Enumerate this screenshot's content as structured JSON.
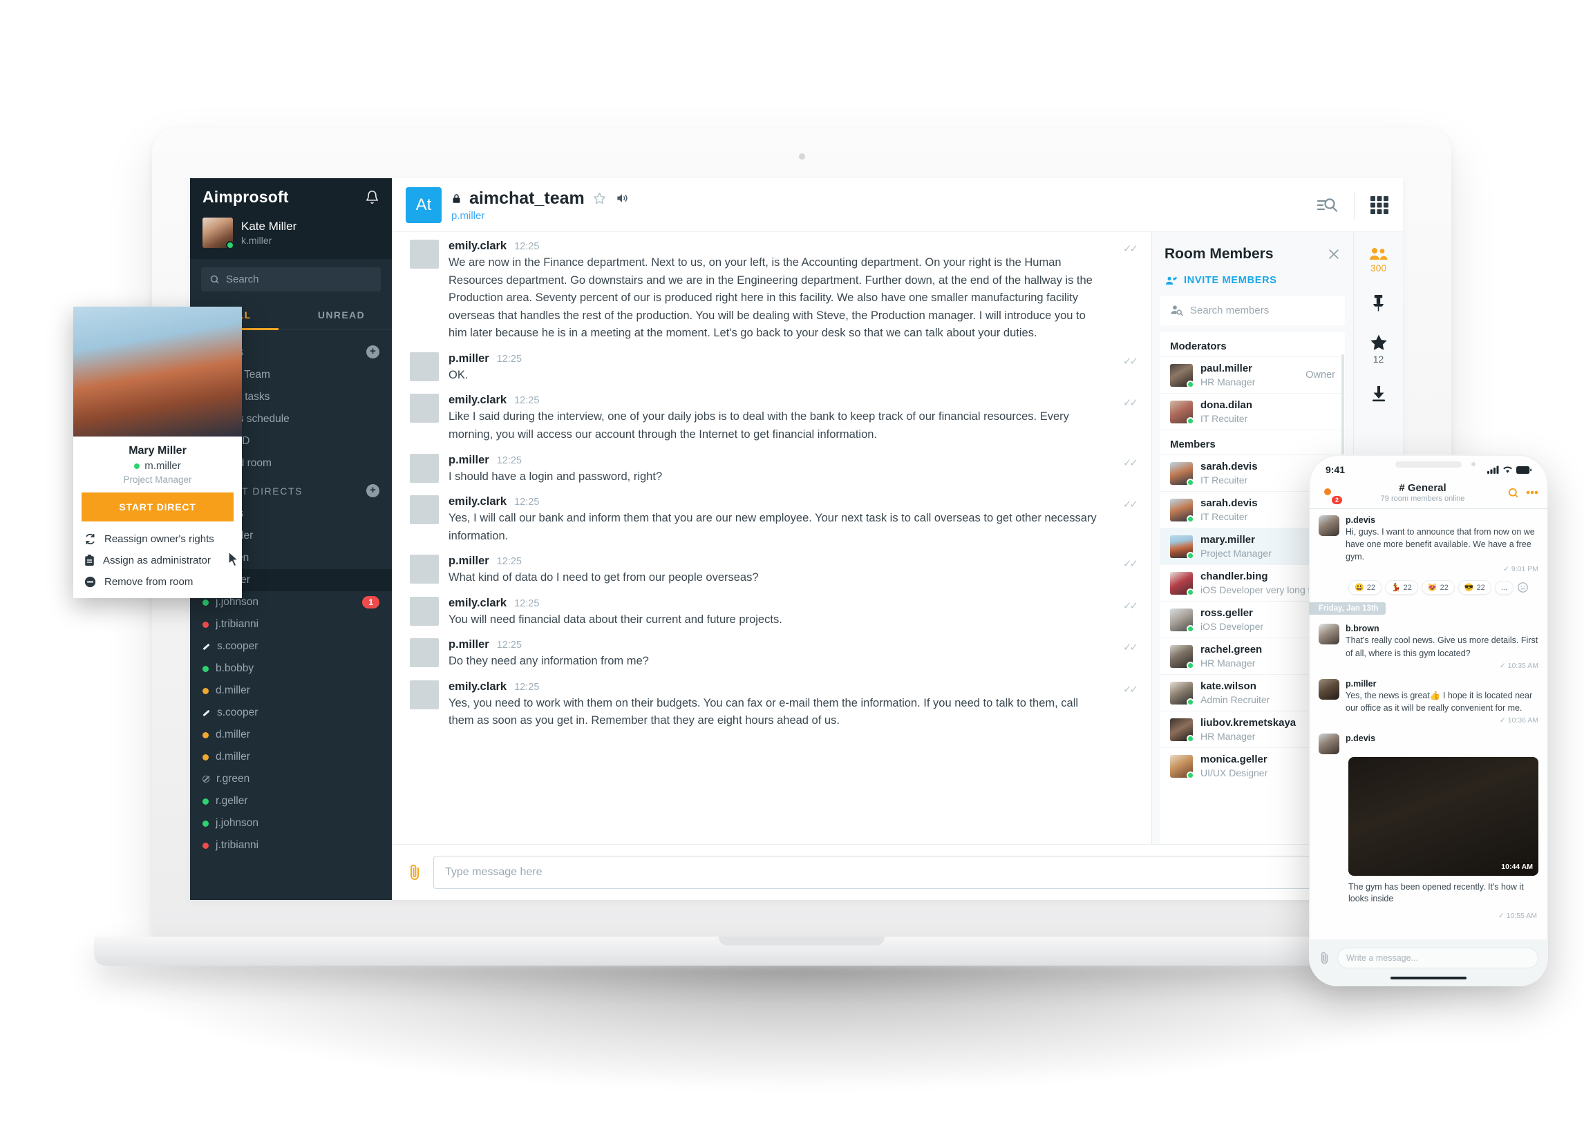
{
  "sidebar": {
    "brand": "Aimprosoft",
    "bell_icon": "bell-icon",
    "user": {
      "name": "Kate Miller",
      "handle": "k.miller",
      "presence": "online"
    },
    "search_placeholder": "Search",
    "tabs": [
      {
        "label": "ALL",
        "active": true
      },
      {
        "label": "UNREAD",
        "active": false
      }
    ],
    "rooms_section": {
      "title": "ROOMS",
      "add_label": "+"
    },
    "rooms": [
      {
        "name": "Aimchat Team"
      },
      {
        "name": "Pending tasks"
      },
      {
        "name": "Holidays schedule"
      },
      {
        "name": "Kate's BD"
      },
      {
        "name": "Archived room"
      }
    ],
    "directs_section": {
      "title": "RECENT DIRECTS",
      "add_label": "+"
    },
    "directs": [
      {
        "name": "Notes",
        "presence": "online",
        "badge": ""
      },
      {
        "name": "m.miller",
        "presence": "online",
        "badge": ""
      },
      {
        "name": "r.green",
        "presence": "online",
        "badge": ""
      },
      {
        "name": "d.miller",
        "presence": "away",
        "badge": "",
        "selected": true
      },
      {
        "name": "j.johnson",
        "presence": "online",
        "badge": "1"
      },
      {
        "name": "j.tribianni",
        "presence": "busy",
        "badge": ""
      },
      {
        "name": "s.cooper",
        "presence": "writing",
        "badge": ""
      },
      {
        "name": "b.bobby",
        "presence": "online",
        "badge": ""
      },
      {
        "name": "d.miller",
        "presence": "away",
        "badge": ""
      },
      {
        "name": "s.cooper",
        "presence": "writing",
        "badge": ""
      },
      {
        "name": "d.miller",
        "presence": "away",
        "badge": ""
      },
      {
        "name": "d.miller",
        "presence": "away",
        "badge": ""
      },
      {
        "name": "r.green",
        "presence": "offline",
        "badge": ""
      },
      {
        "name": "r.geller",
        "presence": "online",
        "badge": ""
      },
      {
        "name": "j.johnson",
        "presence": "online",
        "badge": ""
      },
      {
        "name": "j.tribianni",
        "presence": "busy",
        "badge": ""
      }
    ]
  },
  "profile_popup": {
    "name": "Mary Miller",
    "handle": "m.miller",
    "role": "Project Manager",
    "cta": "START DIRECT",
    "menu": [
      {
        "label": "Reassign owner's rights",
        "icon": "refresh-icon"
      },
      {
        "label": "Assign as administrator",
        "icon": "badge-id-icon"
      },
      {
        "label": "Remove from room",
        "icon": "minus-circle-icon"
      }
    ]
  },
  "chat": {
    "avatar_initials": "At",
    "title": "aimchat_team",
    "lock_icon": "lock-icon",
    "star_icon": "star-outline-icon",
    "speaker_icon": "speaker-icon",
    "owner": "p.miller",
    "search_icon": "search-list-icon",
    "grid_icon": "grid-apps-icon",
    "messages": [
      {
        "author": "emily.clark",
        "time": "12:25",
        "avatar": "p-emily",
        "ticks": true,
        "text": "We are now in the Finance department. Next to us, on your left, is the Accounting department. On your right is the Human Resources department. Go downstairs and we are in the Engineering department. Further down, at the end of the hallway is the Production area. Seventy percent of our is produced right here in this facility. We also have one smaller manufacturing facility overseas that handles the rest of the production. You will be dealing with Steve, the Production manager. I will introduce you to him later because he is in a meeting at the moment. Let's go back to your desk so that we can talk about your duties."
      },
      {
        "author": "p.miller",
        "time": "12:25",
        "avatar": "p-pmiller",
        "ticks": true,
        "text": "OK."
      },
      {
        "author": "emily.clark",
        "time": "12:25",
        "avatar": "p-emily",
        "ticks": true,
        "text": "Like I said during the interview, one of your daily jobs is to deal with the bank to keep track of our financial resources. Every morning, you will access our account through the Internet to get financial information."
      },
      {
        "author": "p.miller",
        "time": "12:25",
        "avatar": "p-pmiller",
        "ticks": true,
        "text": "I should have a login and password, right?"
      },
      {
        "author": "emily.clark",
        "time": "12:25",
        "avatar": "p-emily",
        "ticks": true,
        "text": "Yes, I will call our bank and inform them that you are our new employee. Your next task is to call overseas to get other necessary information."
      },
      {
        "author": "p.miller",
        "time": "12:25",
        "avatar": "p-pmiller",
        "ticks": true,
        "text": "What kind of data do I need to get from our people overseas?"
      },
      {
        "author": "emily.clark",
        "time": "12:25",
        "avatar": "p-emily",
        "ticks": true,
        "text": "You will need financial data about their current and future projects."
      },
      {
        "author": "p.miller",
        "time": "12:25",
        "avatar": "p-pmiller",
        "ticks": true,
        "text": "Do they need any information from me?"
      },
      {
        "author": "emily.clark",
        "time": "12:25",
        "avatar": "p-emily",
        "ticks": true,
        "text": "Yes, you need to work with them on their budgets. You can fax or e-mail them the information. If you need to talk to them, call them as soon as you get in. Remember that they are eight hours ahead of us."
      }
    ],
    "composer": {
      "attach_icon": "paperclip-icon",
      "placeholder": "Type message here",
      "emoji_icon": "emoji-icon",
      "send_icon": "send-icon"
    }
  },
  "members_panel": {
    "title": "Room Members",
    "close_icon": "close-icon",
    "invite_label": "INVITE MEMBERS",
    "invite_icon": "add-people-icon",
    "search_placeholder": "Search members",
    "search_icon": "person-search-icon",
    "groups": [
      {
        "name": "Moderators",
        "members": [
          {
            "username": "paul.miller",
            "role": "HR Manager",
            "tag": "Owner",
            "avatar": "p-paul",
            "presence": "online"
          },
          {
            "username": "dona.dilan",
            "role": "IT Recuiter",
            "tag": "",
            "avatar": "p-dona",
            "presence": "online"
          }
        ]
      },
      {
        "name": "Members",
        "members": [
          {
            "username": "sarah.devis",
            "role": "IT Recuiter",
            "tag": "",
            "avatar": "p-sarah",
            "presence": "online"
          },
          {
            "username": "sarah.devis",
            "role": "IT Recuiter",
            "tag": "",
            "avatar": "p-sarah",
            "presence": "online"
          },
          {
            "username": "mary.miller",
            "role": "Project Manager",
            "tag": "",
            "avatar": "p-mary",
            "presence": "online",
            "highlight": true
          },
          {
            "username": "chandler.bing",
            "role": "iOS Developer very long title of",
            "tag": "",
            "avatar": "p-chand",
            "presence": "online"
          },
          {
            "username": "ross.geller",
            "role": "iOS Developer",
            "tag": "",
            "avatar": "p-ross",
            "presence": "online"
          },
          {
            "username": "rachel.green",
            "role": "HR Manager",
            "tag": "",
            "avatar": "p-rachel",
            "presence": "online"
          },
          {
            "username": "kate.wilson",
            "role": "Admin Recruiter",
            "tag": "",
            "avatar": "p-katew",
            "presence": "online"
          },
          {
            "username": "liubov.kremetskaya",
            "role": "HR Manager",
            "tag": "",
            "avatar": "p-liubov",
            "presence": "online"
          },
          {
            "username": "monica.geller",
            "role": "UI/UX Designer",
            "tag": "",
            "avatar": "p-monica",
            "presence": "online"
          }
        ]
      }
    ]
  },
  "rail": [
    {
      "icon": "people-icon",
      "count": "300",
      "accent": true
    },
    {
      "icon": "pin-icon",
      "count": ""
    },
    {
      "icon": "star-filled-icon",
      "count": "12"
    },
    {
      "icon": "download-icon",
      "count": ""
    }
  ],
  "phone": {
    "status": {
      "time": "9:41",
      "signal_icon": "signal-icon",
      "wifi_icon": "wifi-icon",
      "battery_icon": "battery-icon"
    },
    "header": {
      "logo_icon": "app-logo-icon",
      "logo_badge": "2",
      "title": "# General",
      "subtitle": "79 room members online",
      "search_icon": "search-icon",
      "more_icon": "more-dots-icon"
    },
    "messages": [
      {
        "author": "p.devis",
        "avatar": "p-pdevis",
        "text": "Hi, guys. I want to announce that from now on we have one more benefit available. We have a free gym.",
        "time": "9:01 PM",
        "tick": "✓",
        "reactions": [
          {
            "emoji": "😃",
            "count": "22"
          },
          {
            "emoji": "💃",
            "count": "22"
          },
          {
            "emoji": "😻",
            "count": "22"
          },
          {
            "emoji": "😎",
            "count": "22"
          }
        ],
        "more_reactions": "...",
        "add_reaction_icon": "add-emoji-icon"
      }
    ],
    "day_divider": "Friday, Jan 13th",
    "messages2": [
      {
        "author": "b.brown",
        "avatar": "p-bbrown",
        "text": "That's really cool news. Give us more details. First of all, where is this gym located?",
        "time": "10:35 AM",
        "tick": "✓"
      },
      {
        "author": "p.miller",
        "avatar": "p-pmil2",
        "text": "Yes, the news is great👍 I hope it is located near our office as it will be really convenient for me.",
        "time": "10:36 AM",
        "tick": "✓"
      }
    ],
    "image_message": {
      "author": "p.devis",
      "avatar": "p-pdevis",
      "image_alt": "gym-photo",
      "image_time": "10:44 AM",
      "caption": "The gym has been opened recently. It's how it looks inside",
      "caption_time": "10:55 AM",
      "caption_tick": "✓"
    },
    "composer": {
      "attach_icon": "paperclip-icon",
      "placeholder": "Write a message..."
    }
  },
  "colors": {
    "accent_orange": "#f5a623",
    "brand_blue": "#1aa7ec",
    "sidebar_dark": "#1f2d36",
    "online_green": "#2dd36f",
    "busy_red": "#f04b4b",
    "away_amber": "#f0a92e"
  }
}
